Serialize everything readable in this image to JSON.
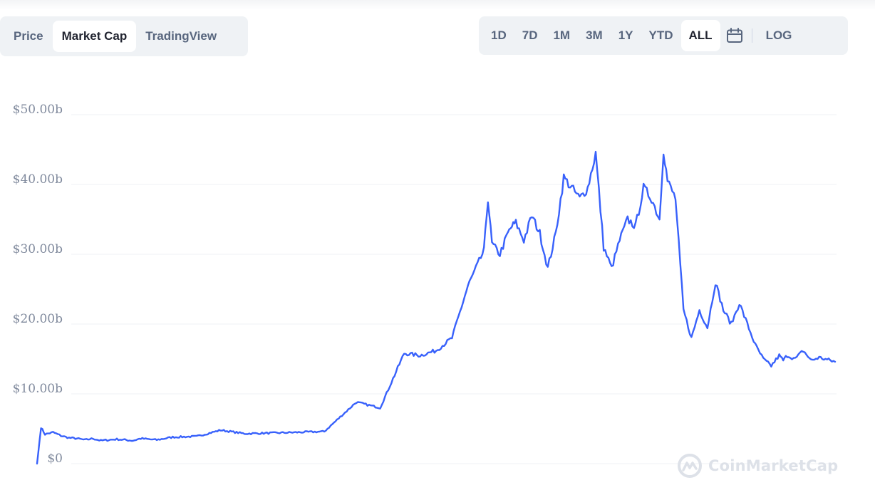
{
  "tabs": [
    {
      "label": "Price",
      "active": false
    },
    {
      "label": "Market Cap",
      "active": true
    },
    {
      "label": "TradingView",
      "active": false
    }
  ],
  "ranges": [
    {
      "label": "1D",
      "active": false
    },
    {
      "label": "7D",
      "active": false
    },
    {
      "label": "1M",
      "active": false
    },
    {
      "label": "3M",
      "active": false
    },
    {
      "label": "1Y",
      "active": false
    },
    {
      "label": "YTD",
      "active": false
    },
    {
      "label": "ALL",
      "active": true
    }
  ],
  "log_label": "LOG",
  "watermark": "CoinMarketCap",
  "colors": {
    "line": "#3861fb",
    "grid": "#eff2f5",
    "active_bg": "#ffffff",
    "panel_bg": "#eff2f5"
  },
  "icons": {
    "calendar": "calendar-icon",
    "logo": "coinmarketcap-logo-icon"
  },
  "chart_data": {
    "type": "line",
    "title": "",
    "xlabel": "",
    "ylabel": "",
    "ylim": [
      0,
      50
    ],
    "y_unit": "billion USD",
    "grid": true,
    "yticks": [
      0,
      10,
      20,
      30,
      40,
      50
    ],
    "ytick_labels": [
      "$0",
      "$10.00b",
      "$20.00b",
      "$30.00b",
      "$40.00b",
      "$50.00b"
    ],
    "x": [
      0,
      0.5,
      1,
      2,
      3,
      4,
      5,
      6,
      7,
      8,
      10,
      12,
      13,
      15,
      17,
      20,
      23,
      26,
      30,
      33,
      36,
      40,
      43,
      46,
      48,
      50,
      52,
      54,
      55,
      56,
      56.5,
      57,
      58,
      59,
      59.5,
      60,
      61,
      62,
      63,
      64,
      65,
      66,
      67,
      68,
      69,
      70,
      71,
      72,
      73,
      74,
      75,
      76,
      77,
      78,
      78.5,
      79,
      80,
      81,
      82,
      83,
      84,
      85,
      86,
      87,
      88,
      89,
      90,
      91,
      92,
      93,
      93.5,
      94,
      95,
      96,
      97,
      98,
      99,
      100
    ],
    "y": [
      0,
      5.2,
      4.2,
      4.5,
      4.0,
      3.7,
      3.6,
      3.4,
      3.6,
      3.3,
      3.5,
      3.3,
      3.6,
      3.4,
      3.8,
      3.9,
      4.8,
      4.3,
      4.4,
      4.5,
      4.6,
      8.8,
      8.0,
      15.8,
      15.5,
      16.2,
      18.0,
      25.5,
      28.0,
      30.5,
      38.0,
      31.5,
      30.0,
      33.0,
      34.0,
      34.5,
      32.0,
      35.5,
      33.0,
      28.0,
      33.0,
      41.0,
      39.5,
      38.0,
      39.5,
      44.5,
      31.0,
      28.0,
      32.0,
      35.0,
      34.0,
      39.5,
      38.0,
      35.0,
      45.0,
      40.5,
      38.0,
      22.0,
      18.0,
      22.0,
      19.5,
      26.0,
      22.0,
      20.0,
      23.0,
      20.0,
      17.0,
      15.0,
      14.0,
      15.5,
      14.8,
      15.5,
      15.0,
      16.2,
      14.8,
      15.2,
      14.9,
      14.6
    ]
  }
}
